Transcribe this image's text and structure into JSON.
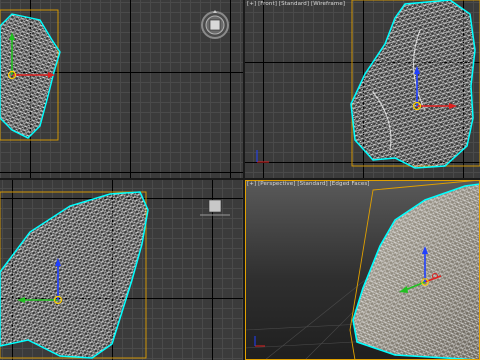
{
  "viewports": {
    "top": {
      "label": ""
    },
    "front": {
      "menu": "[+]",
      "view": "[Front]",
      "shading": "[Standard]",
      "mode": "[Wireframe]"
    },
    "left": {
      "label": ""
    },
    "perspective": {
      "menu": "[+]",
      "view": "[Perspective]",
      "shading": "[Standard]",
      "mode": "[Edged Faces]"
    }
  },
  "icons": [
    "viewcube-icon",
    "orthographic-nav-cube-icon",
    "transform-gizmo-icon",
    "axis-tripod-icon"
  ],
  "colors": {
    "selection_wire": "#00ffff",
    "mesh_wire": "#ffffff",
    "bounding_box": "#e0a000",
    "axis_x": "#e02020",
    "axis_y": "#20c020",
    "axis_z": "#2040ff",
    "gizmo_center": "#ffd000"
  }
}
